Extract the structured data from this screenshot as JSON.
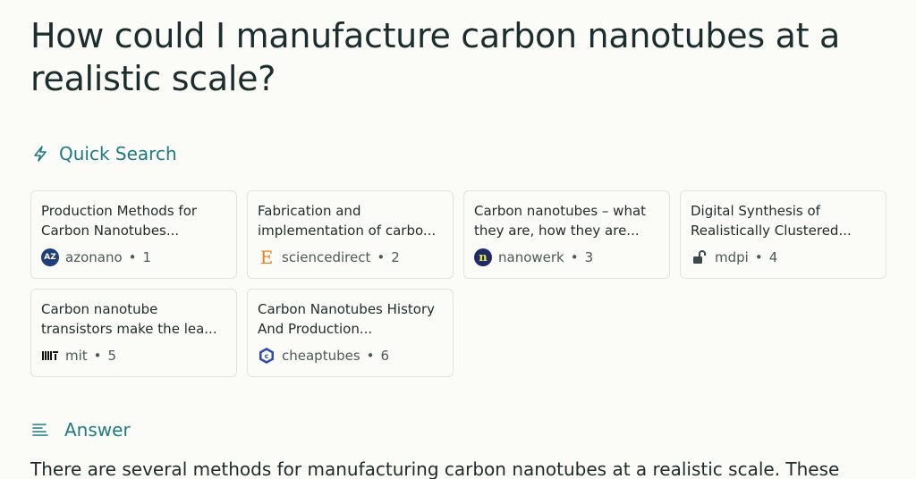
{
  "question": "How could I manufacture carbon nanotubes at a realistic scale?",
  "quick_search": {
    "label": "Quick Search",
    "icon": "lightning-icon",
    "accent_color": "#1f7a80"
  },
  "sources": [
    {
      "title": "Production Methods for Carbon Nanotubes...",
      "site": "azonano",
      "index": "1",
      "icon": "azonano-favicon"
    },
    {
      "title": "Fabrication and implementation of carbo...",
      "site": "sciencedirect",
      "index": "2",
      "icon": "sciencedirect-favicon"
    },
    {
      "title": "Carbon nanotubes – what they are, how they are...",
      "site": "nanowerk",
      "index": "3",
      "icon": "nanowerk-favicon"
    },
    {
      "title": "Digital Synthesis of Realistically Clustered...",
      "site": "mdpi",
      "index": "4",
      "icon": "mdpi-favicon"
    },
    {
      "title": "Carbon nanotube transistors make the lea...",
      "site": "mit",
      "index": "5",
      "icon": "mit-favicon"
    },
    {
      "title": "Carbon Nanotubes History And Production...",
      "site": "cheaptubes",
      "index": "6",
      "icon": "cheaptubes-favicon"
    }
  ],
  "answer": {
    "label": "Answer",
    "icon": "text-lines-icon",
    "text": "There are several methods for manufacturing carbon nanotubes at a realistic scale. These"
  },
  "separator": "•"
}
